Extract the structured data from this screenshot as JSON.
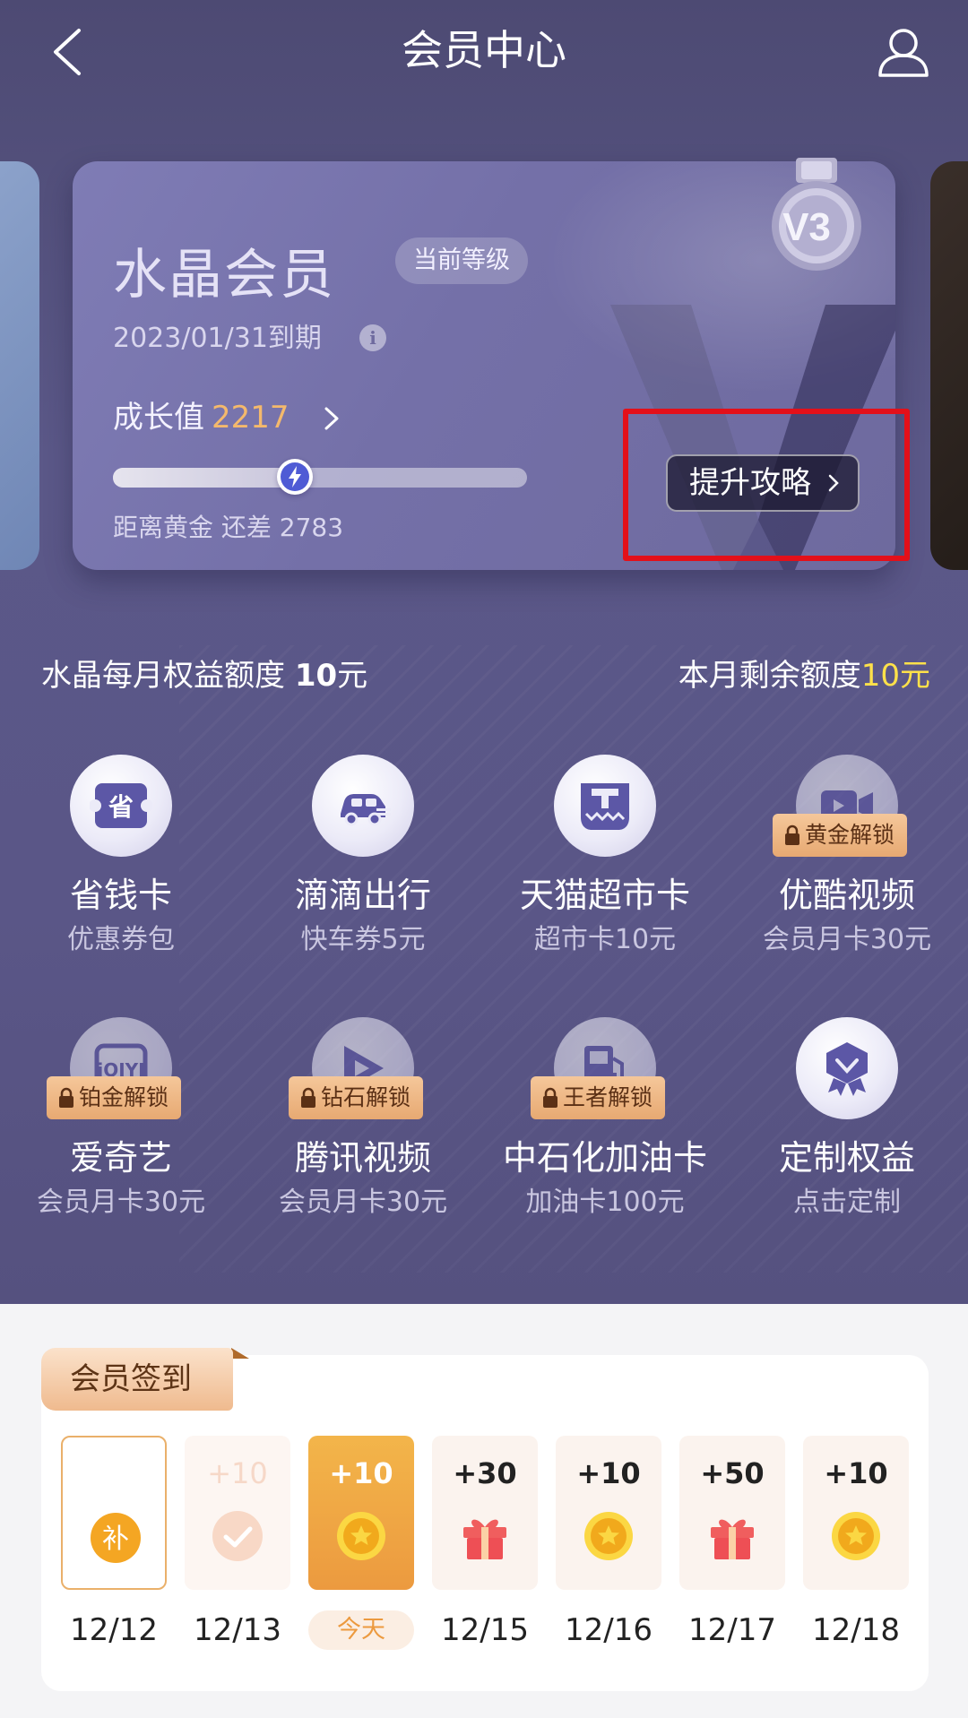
{
  "header": {
    "title": "会员中心",
    "back_icon": "chevron-left-icon",
    "profile_icon": "user-icon"
  },
  "membership_card": {
    "tier_name": "水晶会员",
    "level_badge": "当前等级",
    "expiry": "2023/01/31到期",
    "info_icon": "info-icon",
    "growth_label": "成长值",
    "growth_value": "2217",
    "progress_fraction": 0.44,
    "gap_text": "距离黄金 还差 2783",
    "upgrade_button": "提升攻略",
    "medal_label": "V3"
  },
  "quota": {
    "monthly_label": "水晶每月权益额度",
    "monthly_amount": "10",
    "monthly_unit": "元",
    "remaining_label": "本月剩余额度",
    "remaining_amount": "10元"
  },
  "benefits": [
    {
      "title": "省钱卡",
      "subtitle": "优惠券包",
      "icon": "coupon-icon",
      "lock": ""
    },
    {
      "title": "滴滴出行",
      "subtitle": "快车券5元",
      "icon": "car-icon",
      "lock": ""
    },
    {
      "title": "天猫超市卡",
      "subtitle": "超市卡10元",
      "icon": "tmall-icon",
      "lock": ""
    },
    {
      "title": "优酷视频",
      "subtitle": "会员月卡30元",
      "icon": "video-icon",
      "lock": "黄金解锁"
    },
    {
      "title": "爱奇艺",
      "subtitle": "会员月卡30元",
      "icon": "iqiyi-icon",
      "lock": "铂金解锁"
    },
    {
      "title": "腾讯视频",
      "subtitle": "会员月卡30元",
      "icon": "play-icon",
      "lock": "钻石解锁"
    },
    {
      "title": "中石化加油卡",
      "subtitle": "加油卡100元",
      "icon": "fuel-icon",
      "lock": "王者解锁"
    },
    {
      "title": "定制权益",
      "subtitle": "点击定制",
      "icon": "badge-icon",
      "lock": ""
    }
  ],
  "signin": {
    "title": "会员签到",
    "today_label": "今天",
    "makeup_label": "补",
    "days": [
      {
        "date": "12/12",
        "points": "",
        "state": "makeup",
        "icon": "makeup-icon"
      },
      {
        "date": "12/13",
        "points": "+10",
        "state": "done",
        "icon": "check-icon"
      },
      {
        "date": "",
        "points": "+10",
        "state": "today",
        "icon": "coin-icon"
      },
      {
        "date": "12/15",
        "points": "+30",
        "state": "future",
        "icon": "gift-icon"
      },
      {
        "date": "12/16",
        "points": "+10",
        "state": "future",
        "icon": "coin-icon"
      },
      {
        "date": "12/17",
        "points": "+50",
        "state": "future",
        "icon": "gift-icon"
      },
      {
        "date": "12/18",
        "points": "+10",
        "state": "future",
        "icon": "coin-icon"
      }
    ]
  },
  "colors": {
    "accent_orange": "#f4b96c",
    "accent_yellow": "#ffe14a",
    "highlight_red": "#e3101a"
  }
}
